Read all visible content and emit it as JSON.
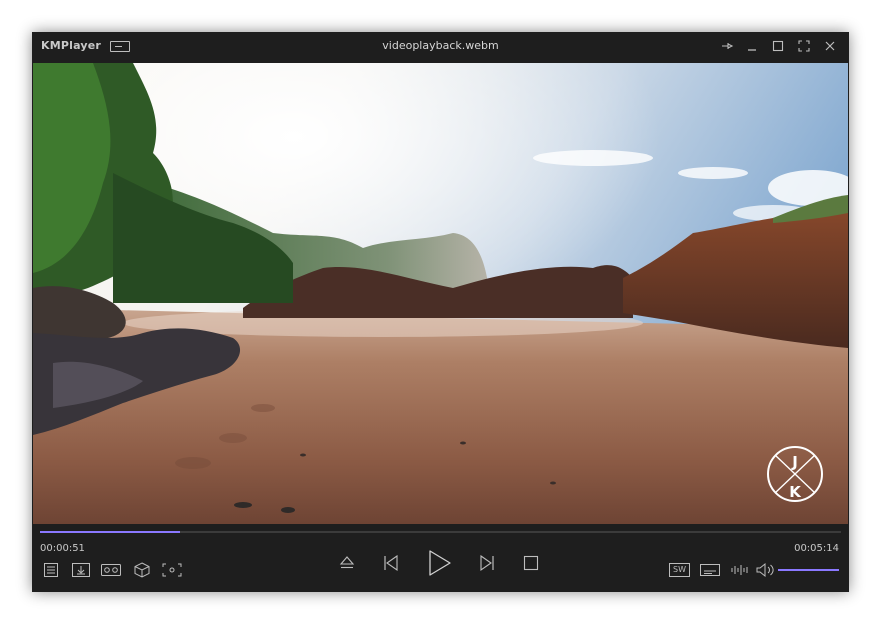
{
  "app": {
    "logo": "KMPlayer",
    "title": "videoplayback.webm"
  },
  "window_controls": {
    "pin": "pin-icon",
    "minimize": "minimize-icon",
    "maximize": "maximize-icon",
    "fullscreen": "fullscreen-icon",
    "close": "close-icon"
  },
  "video": {
    "watermark_top": "J",
    "watermark_bottom": "K"
  },
  "playback": {
    "current_time": "00:00:51",
    "total_time": "00:05:14",
    "progress": 0.175,
    "volume": 1.0
  },
  "controls_left": [
    "playlist-icon",
    "download-icon",
    "vr-goggles-icon",
    "3d-cube-icon",
    "capture-icon"
  ],
  "controls_center": [
    "eject-icon",
    "previous-icon",
    "play-icon",
    "next-icon",
    "stop-icon"
  ],
  "controls_right": {
    "sw_label": "SW",
    "icons": [
      "subtitle-icon",
      "audio-eq-icon",
      "speaker-icon"
    ]
  },
  "colors": {
    "accent": "#8a78ff",
    "background": "#1e1e1e",
    "text": "#c8c8c8"
  }
}
